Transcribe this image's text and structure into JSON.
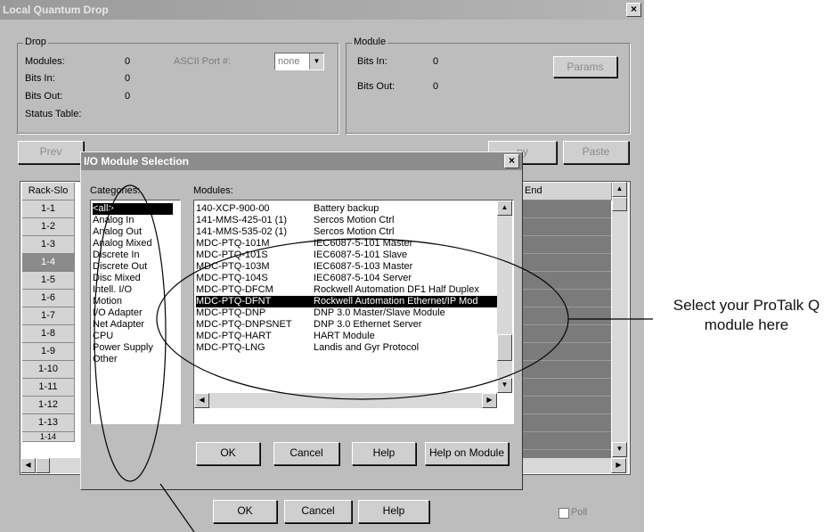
{
  "window": {
    "title": "Local Quantum Drop",
    "close": "×"
  },
  "drop": {
    "label": "Drop",
    "modules_label": "Modules:",
    "modules_value": "0",
    "bits_in_label": "Bits In:",
    "bits_in_value": "0",
    "bits_out_label": "Bits Out:",
    "bits_out_value": "0",
    "status_table_label": "Status Table:",
    "ascii_port_label": "ASCII Port #:",
    "ascii_port_value": "none"
  },
  "module": {
    "label": "Module",
    "bits_in_label": "Bits In:",
    "bits_in_value": "0",
    "bits_out_label": "Bits Out:",
    "bits_out_value": "0",
    "params_button": "Params"
  },
  "toolbar": {
    "prev": "Prev",
    "copy": "py",
    "paste": "Paste"
  },
  "grid": {
    "rack_slot_header": "Rack-Slo",
    "end_header": "End",
    "rows": [
      "1-1",
      "1-2",
      "1-3",
      "1-4",
      "1-5",
      "1-6",
      "1-7",
      "1-8",
      "1-9",
      "1-10",
      "1-11",
      "1-12",
      "1-13",
      "1-14"
    ],
    "selected_row": "1-4"
  },
  "dialog": {
    "title": "I/O Module Selection",
    "close": "×",
    "categories_label": "Categories:",
    "modules_label": "Modules:",
    "categories": [
      "<all>",
      "Analog In",
      "Analog Out",
      "Analog Mixed",
      "Discrete In",
      "Discrete Out",
      "Disc Mixed",
      "Intell. I/O",
      "Motion",
      "I/O Adapter",
      "Net Adapter",
      "CPU",
      "Power Supply",
      "Other"
    ],
    "modules": [
      {
        "name": "140-XCP-900-00",
        "desc": "Battery backup"
      },
      {
        "name": "141-MMS-425-01 (1)",
        "desc": "Sercos Motion Ctrl"
      },
      {
        "name": "141-MMS-535-02 (1)",
        "desc": "Sercos Motion Ctrl"
      },
      {
        "name": "MDC-PTQ-101M",
        "desc": "IEC6087-5-101 Master"
      },
      {
        "name": "MDC-PTQ-101S",
        "desc": "IEC6087-5-101 Slave"
      },
      {
        "name": "MDC-PTQ-103M",
        "desc": "IEC6087-5-103 Master"
      },
      {
        "name": "MDC-PTQ-104S",
        "desc": "IEC6087-5-104 Server"
      },
      {
        "name": "MDC-PTQ-DFCM",
        "desc": "Rockwell Automation DF1 Half Duplex"
      },
      {
        "name": "MDC-PTQ-DFNT",
        "desc": "Rockwell Automation Ethernet/IP Mod"
      },
      {
        "name": "MDC-PTQ-DNP",
        "desc": "DNP 3.0 Master/Slave Module"
      },
      {
        "name": "MDC-PTQ-DNPSNET",
        "desc": "DNP 3.0 Ethernet Server"
      },
      {
        "name": "MDC-PTQ-HART",
        "desc": "HART Module"
      },
      {
        "name": "MDC-PTQ-LNG",
        "desc": "Landis and Gyr Protocol"
      }
    ],
    "selected_module": "MDC-PTQ-DFNT",
    "ok": "OK",
    "cancel": "Cancel",
    "help": "Help",
    "help_on_module": "Help on Module"
  },
  "footer": {
    "ok": "OK",
    "cancel": "Cancel",
    "help": "Help",
    "poll": "Poll"
  },
  "annotation": {
    "line1": "Select your ProTalk Q",
    "line2": "module here"
  }
}
